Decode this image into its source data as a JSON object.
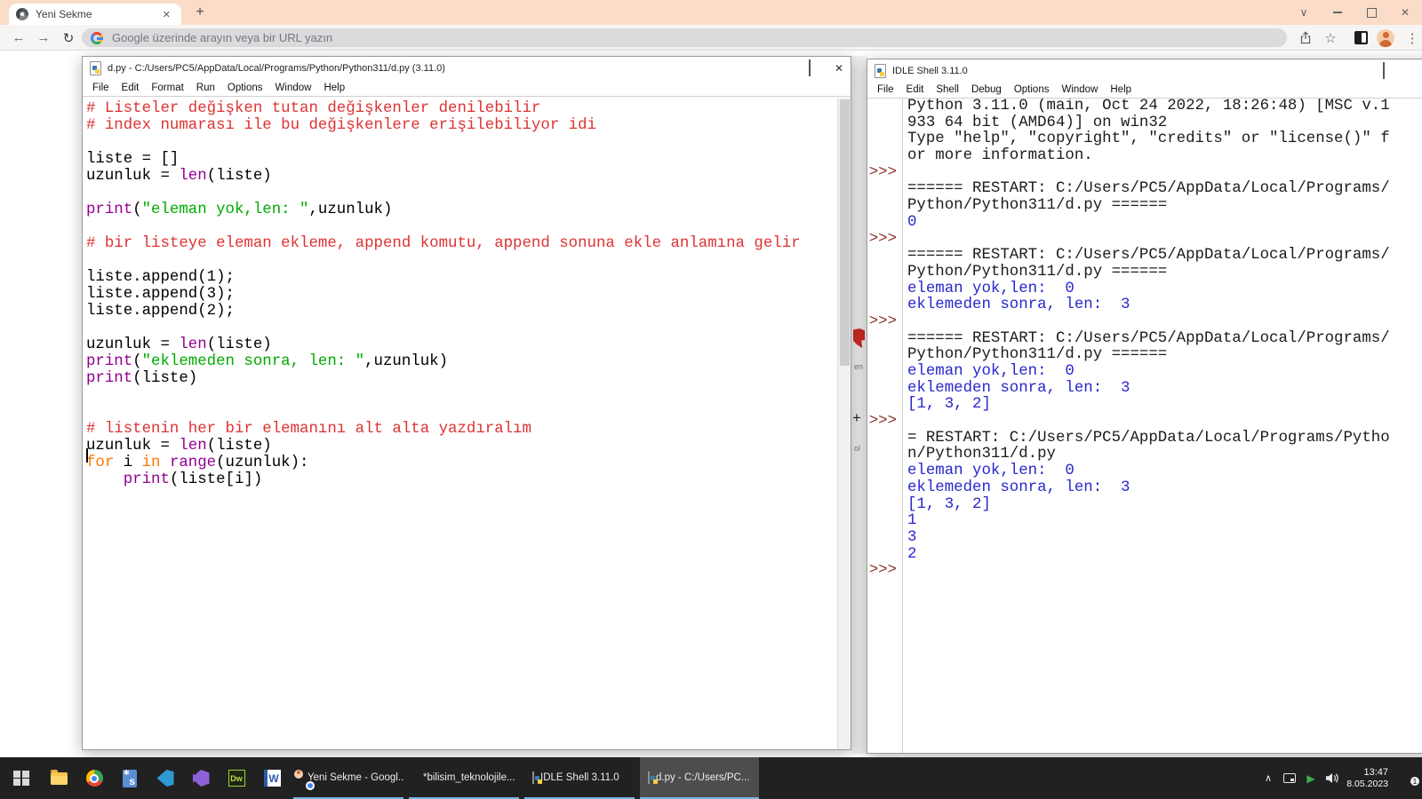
{
  "browser": {
    "tab_title": "Yeni Sekme",
    "address_placeholder": "Google üzerinde arayın veya bir URL yazın"
  },
  "editor": {
    "title": "d.py - C:/Users/PC5/AppData/Local/Programs/Python/Python311/d.py (3.11.0)",
    "menu": [
      "File",
      "Edit",
      "Format",
      "Run",
      "Options",
      "Window",
      "Help"
    ],
    "code_lines": [
      [
        [
          "# Listeler değişken tutan değişkenler denilebilir",
          "com"
        ]
      ],
      [
        [
          "# index numarası ile bu değişkenlere erişilebiliyor idi",
          "com"
        ]
      ],
      [],
      [
        [
          "liste = []",
          "nor"
        ]
      ],
      [
        [
          "uzunluk = ",
          "nor"
        ],
        [
          "len",
          "blt"
        ],
        [
          "(liste)",
          "nor"
        ]
      ],
      [],
      [
        [
          "print",
          "blt"
        ],
        [
          "(",
          "nor"
        ],
        [
          "\"eleman yok,len: \"",
          "str"
        ],
        [
          ",uzunluk)",
          "nor"
        ]
      ],
      [],
      [
        [
          "# bir listeye eleman ekleme, append komutu, append sonuna ekle anlamına gelir",
          "com"
        ]
      ],
      [],
      [
        [
          "liste.append(1);",
          "nor"
        ]
      ],
      [
        [
          "liste.append(3);",
          "nor"
        ]
      ],
      [
        [
          "liste.append(2);",
          "nor"
        ]
      ],
      [],
      [
        [
          "uzunluk = ",
          "nor"
        ],
        [
          "len",
          "blt"
        ],
        [
          "(liste)",
          "nor"
        ]
      ],
      [
        [
          "print",
          "blt"
        ],
        [
          "(",
          "nor"
        ],
        [
          "\"eklemeden sonra, len: \"",
          "str"
        ],
        [
          ",uzunluk)",
          "nor"
        ]
      ],
      [
        [
          "print",
          "blt"
        ],
        [
          "(liste)",
          "nor"
        ]
      ],
      [],
      [],
      [
        [
          "# listenin her bir elemanını alt alta yazdıralım",
          "com"
        ]
      ],
      [
        [
          "uzunluk = ",
          "nor"
        ],
        [
          "len",
          "blt"
        ],
        [
          "(liste)",
          "nor"
        ]
      ],
      [
        [
          "for",
          "key"
        ],
        [
          " i ",
          "nor"
        ],
        [
          "in",
          "key"
        ],
        [
          " ",
          "nor"
        ],
        [
          "range",
          "blt"
        ],
        [
          "(uzunluk):",
          "nor"
        ]
      ],
      [
        [
          "    ",
          "nor"
        ],
        [
          "print",
          "blt"
        ],
        [
          "(liste[i])",
          "nor"
        ]
      ],
      []
    ]
  },
  "shell": {
    "title": "IDLE Shell 3.11.0",
    "menu": [
      "File",
      "Edit",
      "Shell",
      "Debug",
      "Options",
      "Window",
      "Help"
    ],
    "prompt_glyph": ">>>",
    "lines": [
      {
        "prompt": "",
        "text": "Python 3.11.0 (main, Oct 24 2022, 18:26:48) [MSC v.1",
        "color": "con"
      },
      {
        "prompt": "",
        "text": "933 64 bit (AMD64)] on win32",
        "color": "con"
      },
      {
        "prompt": "",
        "text": "Type \"help\", \"copyright\", \"credits\" or \"license()\" f",
        "color": "con"
      },
      {
        "prompt": "",
        "text": "or more information.",
        "color": "con"
      },
      {
        "prompt": ">>>",
        "text": "",
        "color": "con"
      },
      {
        "prompt": "",
        "text": "====== RESTART: C:/Users/PC5/AppData/Local/Programs/",
        "color": "con"
      },
      {
        "prompt": "",
        "text": "Python/Python311/d.py ======",
        "color": "con"
      },
      {
        "prompt": "",
        "text": "0",
        "color": "out"
      },
      {
        "prompt": ">>>",
        "text": "",
        "color": "con"
      },
      {
        "prompt": "",
        "text": "====== RESTART: C:/Users/PC5/AppData/Local/Programs/",
        "color": "con"
      },
      {
        "prompt": "",
        "text": "Python/Python311/d.py ======",
        "color": "con"
      },
      {
        "prompt": "",
        "text": "eleman yok,len:  0",
        "color": "out"
      },
      {
        "prompt": "",
        "text": "eklemeden sonra, len:  3",
        "color": "out"
      },
      {
        "prompt": ">>>",
        "text": "",
        "color": "con"
      },
      {
        "prompt": "",
        "text": "====== RESTART: C:/Users/PC5/AppData/Local/Programs/",
        "color": "con"
      },
      {
        "prompt": "",
        "text": "Python/Python311/d.py ======",
        "color": "con"
      },
      {
        "prompt": "",
        "text": "eleman yok,len:  0",
        "color": "out"
      },
      {
        "prompt": "",
        "text": "eklemeden sonra, len:  3",
        "color": "out"
      },
      {
        "prompt": "",
        "text": "[1, 3, 2]",
        "color": "out"
      },
      {
        "prompt": ">>>",
        "text": "",
        "color": "con"
      },
      {
        "prompt": "",
        "text": "= RESTART: C:/Users/PC5/AppData/Local/Programs/Pytho",
        "color": "con"
      },
      {
        "prompt": "",
        "text": "n/Python311/d.py",
        "color": "con"
      },
      {
        "prompt": "",
        "text": "eleman yok,len:  0",
        "color": "out"
      },
      {
        "prompt": "",
        "text": "eklemeden sonra, len:  3",
        "color": "out"
      },
      {
        "prompt": "",
        "text": "[1, 3, 2]",
        "color": "out"
      },
      {
        "prompt": "",
        "text": "1",
        "color": "out"
      },
      {
        "prompt": "",
        "text": "3",
        "color": "out"
      },
      {
        "prompt": "",
        "text": "2",
        "color": "out"
      },
      {
        "prompt": ">>>",
        "text": "",
        "color": "con"
      }
    ]
  },
  "desktop_fragments": {
    "text_en": "en",
    "plus": "+",
    "text_ol": "ol"
  },
  "taskbar": {
    "buttons": [
      {
        "app": "chrome",
        "label": "Yeni Sekme - Googl...",
        "focused": false
      },
      {
        "app": "edge",
        "label": "*bilisim_teknolojile...",
        "focused": false
      },
      {
        "app": "idle",
        "label": "IDLE Shell 3.11.0",
        "focused": false
      },
      {
        "app": "pyfile",
        "label": "d.py - C:/Users/PC...",
        "focused": true
      }
    ],
    "tray": {
      "time": "13:47",
      "date": "8.05.2023",
      "badge": "1"
    }
  },
  "icons": {
    "tab_close": "✕",
    "new_tab": "+",
    "win_chevron": "∨",
    "win_close": "✕",
    "back_arrow": "←",
    "forward_arrow": "→",
    "reload": "↻",
    "star": "☆",
    "menu_dots": "⋮",
    "editor_close": "✕",
    "tray_chevron": "∧",
    "tray_play": "▶",
    "s_tile_star": "✱",
    "s_tile_letter": "s",
    "dw_label": "Dw",
    "word_label": "W"
  },
  "colors": {
    "tabstrip": "#fbdcc8",
    "taskbar": "#212121",
    "task_underline": "#76b5e8",
    "code_comment": "#dd3333",
    "code_keyword": "#ff7700",
    "code_builtin": "#900090",
    "code_string": "#00aa00",
    "shell_stdout": "#2727cc",
    "shell_prompt": "#8b352b"
  }
}
